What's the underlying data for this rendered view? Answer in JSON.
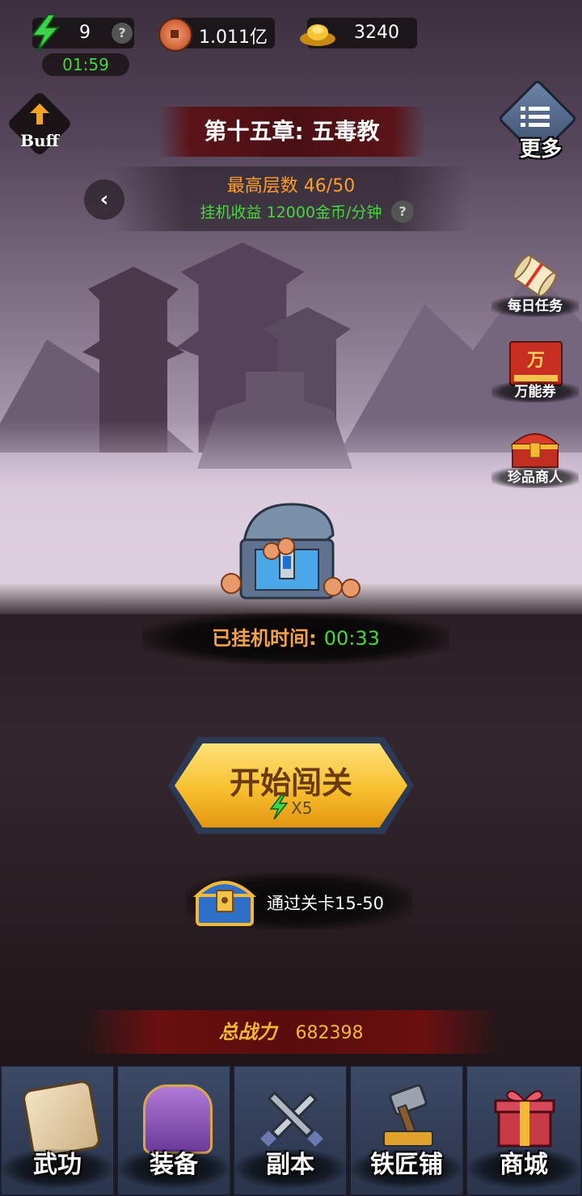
{
  "resources": {
    "energy": "9",
    "energy_timer": "01:59",
    "copper": "1.011亿",
    "gold": "3240"
  },
  "buff_label": "Buff",
  "more_label": "更多",
  "chapter": {
    "title": "第十五章: 五毒教",
    "max_floor": "最高层数 46/50",
    "idle_income": "挂机收益 12000金币/分钟"
  },
  "side_menu": [
    {
      "label": "每日任务"
    },
    {
      "label": "万能券",
      "badge": "万"
    },
    {
      "label": "珍品商人"
    }
  ],
  "idle": {
    "label": "已挂机时间:",
    "time": "00:33"
  },
  "start_button": {
    "label": "开始闯关",
    "cost": "X5"
  },
  "reward": {
    "text": "通过关卡15-50"
  },
  "power": {
    "label": "总战力",
    "value": "682398"
  },
  "nav": [
    {
      "label": "武功"
    },
    {
      "label": "装备"
    },
    {
      "label": "副本"
    },
    {
      "label": "铁匠铺"
    },
    {
      "label": "商城"
    }
  ],
  "colors": {
    "accent_gold": "#f5b731",
    "income_green": "#47d63f",
    "floor_orange": "#ff9a2e"
  }
}
